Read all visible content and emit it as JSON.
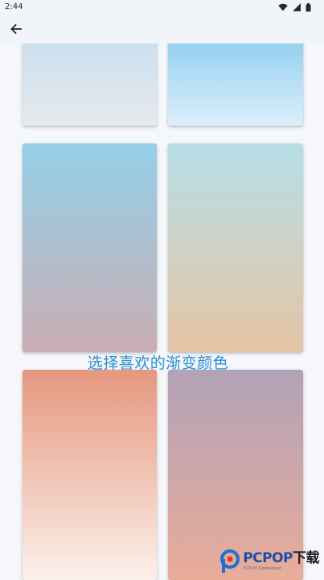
{
  "status_bar": {
    "time": "2:44",
    "icons": [
      "wifi-icon",
      "signal-icon",
      "battery-icon"
    ]
  },
  "app_bar": {
    "back_icon": "arrow-left-icon"
  },
  "gradients": [
    {
      "top": "#c7dfee",
      "bottom": "#e7e9ee"
    },
    {
      "top": "#8ccdef",
      "bottom": "#ddeefb"
    },
    {
      "top": "#94d0e9",
      "bottom": "#c9adb3"
    },
    {
      "top": "#b6dfe7",
      "bottom": "#e6c4a5"
    },
    {
      "top": "#e6977f",
      "bottom": "#fcf0ea"
    },
    {
      "top": "#b2a2b8",
      "bottom": "#e9ac99"
    }
  ],
  "caption": "选择喜欢的渐变颜色",
  "watermark": {
    "brand": "PCPOP",
    "brand_cn": "下载",
    "sub": "PCPOP Download"
  },
  "colors": {
    "caption": "#2a8fd4",
    "brand": "#1d4fa8",
    "app_bar_bg": "#f1f4f8"
  }
}
